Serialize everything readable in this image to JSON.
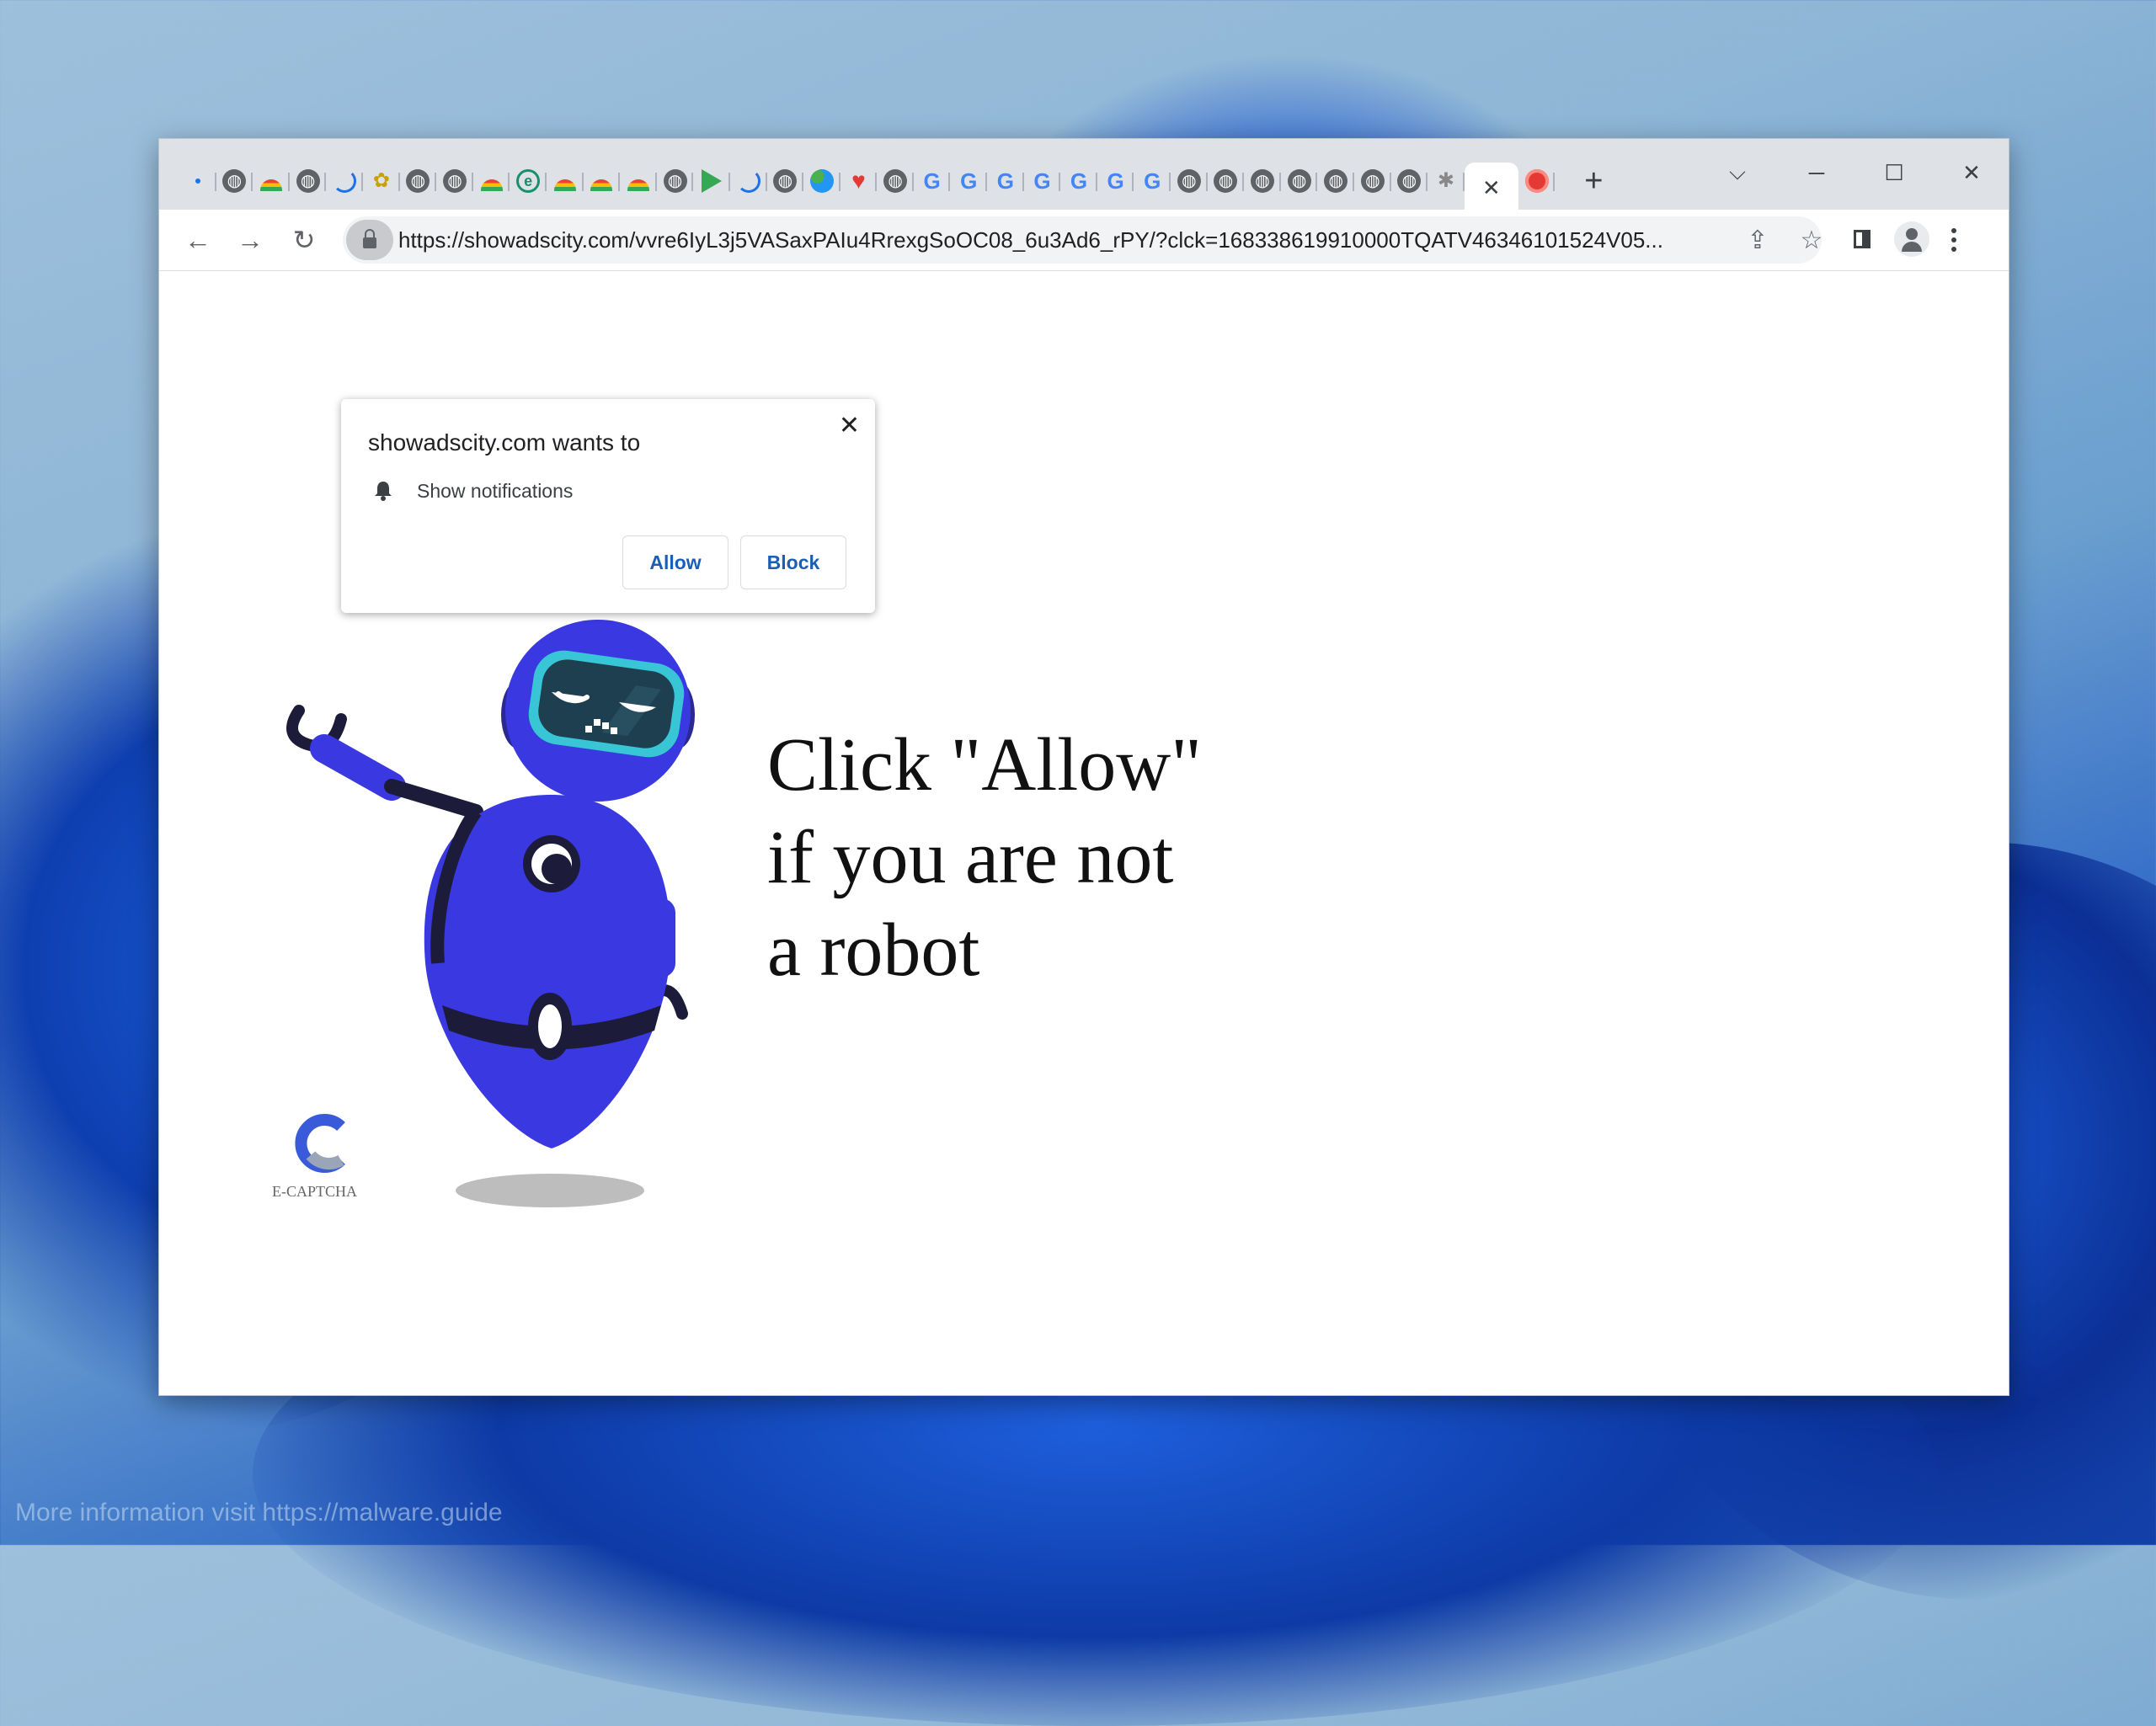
{
  "browser": {
    "tabs": [
      {
        "icon": "loading-dot-icon"
      },
      {
        "icon": "globe-icon"
      },
      {
        "icon": "rainbow-icon"
      },
      {
        "icon": "globe-icon"
      },
      {
        "icon": "spinner-icon"
      },
      {
        "icon": "bee-icon"
      },
      {
        "icon": "globe-icon"
      },
      {
        "icon": "globe-icon"
      },
      {
        "icon": "rainbow-icon"
      },
      {
        "icon": "e-icon"
      },
      {
        "icon": "rainbow-icon"
      },
      {
        "icon": "rainbow-icon"
      },
      {
        "icon": "rainbow-icon"
      },
      {
        "icon": "globe-icon"
      },
      {
        "icon": "play-icon"
      },
      {
        "icon": "spinner-icon"
      },
      {
        "icon": "globe-icon"
      },
      {
        "icon": "blob-icon"
      },
      {
        "icon": "heart-icon"
      },
      {
        "icon": "globe-icon"
      },
      {
        "icon": "google-icon"
      },
      {
        "icon": "google-icon"
      },
      {
        "icon": "google-icon"
      },
      {
        "icon": "google-icon"
      },
      {
        "icon": "google-icon"
      },
      {
        "icon": "google-icon"
      },
      {
        "icon": "google-icon"
      },
      {
        "icon": "globe-icon"
      },
      {
        "icon": "globe-icon"
      },
      {
        "icon": "globe-icon"
      },
      {
        "icon": "globe-icon"
      },
      {
        "icon": "globe-icon"
      },
      {
        "icon": "globe-icon"
      },
      {
        "icon": "globe-icon"
      },
      {
        "icon": "bug-icon"
      }
    ],
    "active_tab_icon": "close-icon",
    "recording_tab_icon": "record-icon",
    "new_tab_label": "+",
    "url": "https://showadscity.com/vvre6IyL3j5VASaxPAIu4RrexgSoOC08_6u3Ad6_rPY/?clck=168338619910000TQATV46346101524V05..."
  },
  "permission_prompt": {
    "title": "showadscity.com wants to",
    "permission": "Show notifications",
    "allow_label": "Allow",
    "block_label": "Block",
    "close_label": "✕"
  },
  "page": {
    "headline_lines": [
      "Click \"Allow\"",
      "if you are not",
      "a robot"
    ],
    "logo_label": "E-CAPTCHA"
  },
  "watermark": "More information visit https://malware.guide",
  "colors": {
    "robot_body": "#3a38e0",
    "robot_dark": "#1c1b3a",
    "visor": "#1e3f4f",
    "visor_rim": "#38c6d6",
    "accent_link": "#1a5fb4"
  }
}
